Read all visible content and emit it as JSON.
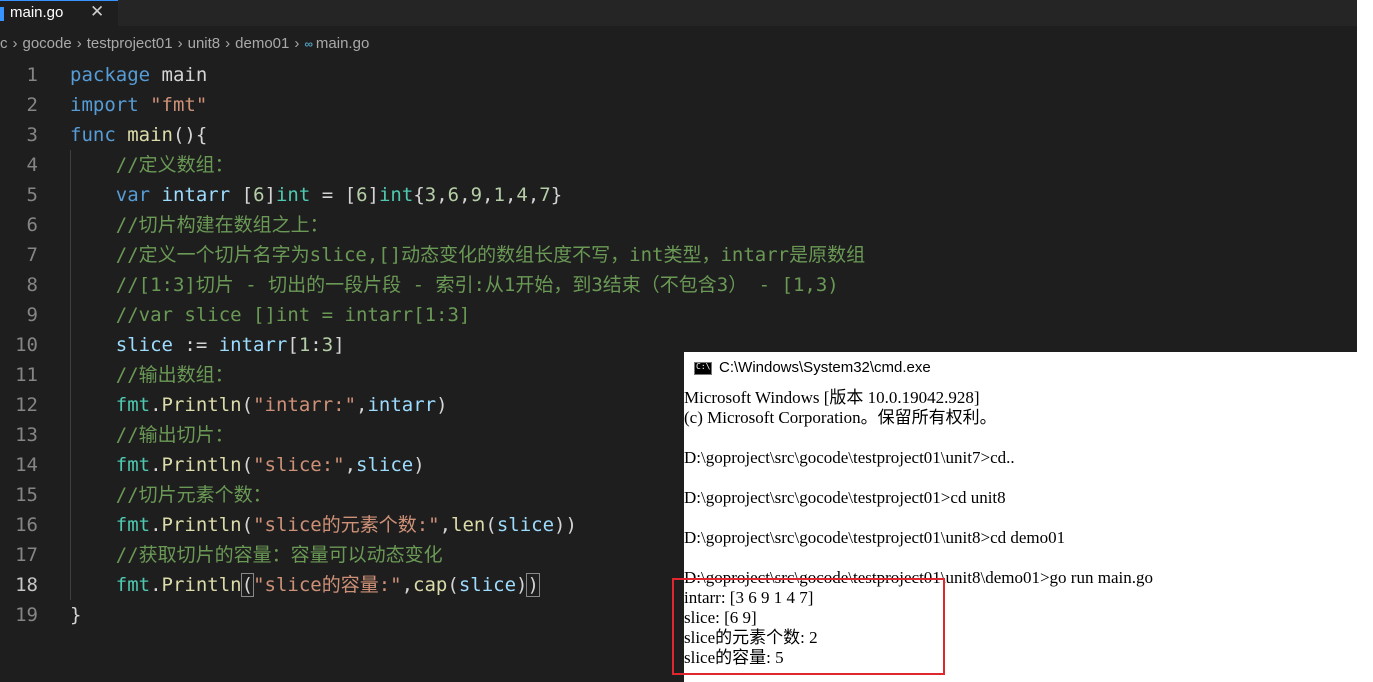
{
  "tab": {
    "label": "main.go",
    "close": "✕"
  },
  "breadcrumb": [
    "c",
    "gocode",
    "testproject01",
    "unit8",
    "demo01",
    "main.go"
  ],
  "breadcrumb_go_icon": "∞",
  "active_line": 18,
  "lines": [
    {
      "n": "1"
    },
    {
      "n": "2"
    },
    {
      "n": "3"
    },
    {
      "n": "4"
    },
    {
      "n": "5"
    },
    {
      "n": "6"
    },
    {
      "n": "7"
    },
    {
      "n": "8"
    },
    {
      "n": "9"
    },
    {
      "n": "10"
    },
    {
      "n": "11"
    },
    {
      "n": "12"
    },
    {
      "n": "13"
    },
    {
      "n": "14"
    },
    {
      "n": "15"
    },
    {
      "n": "16"
    },
    {
      "n": "17"
    },
    {
      "n": "18"
    },
    {
      "n": "19"
    }
  ],
  "code": {
    "l1": [
      "package",
      " main"
    ],
    "l2": [
      "import",
      " ",
      "\"fmt\""
    ],
    "l3": [
      "func",
      " ",
      "main",
      "(){"
    ],
    "l4": "    //定义数组：",
    "l5": [
      "    ",
      "var",
      " ",
      "intarr",
      " [",
      "6",
      "]",
      "int",
      " = [",
      "6",
      "]",
      "int",
      "{",
      "3",
      ",",
      "6",
      ",",
      "9",
      ",",
      "1",
      ",",
      "4",
      ",",
      "7",
      "}"
    ],
    "l6": "    //切片构建在数组之上：",
    "l7": "    //定义一个切片名字为slice,[]动态变化的数组长度不写，int类型，intarr是原数组",
    "l8": "    //[1:3]切片 - 切出的一段片段 - 索引:从1开始，到3结束（不包含3） - [1,3)",
    "l9": "    //var slice []int = intarr[1:3]",
    "l10": [
      "    ",
      "slice",
      " := ",
      "intarr",
      "[",
      "1",
      ":",
      "3",
      "]"
    ],
    "l11": "    //输出数组：",
    "l12": [
      "    ",
      "fmt",
      ".",
      "Println",
      "(",
      "\"intarr:\"",
      ",",
      "intarr",
      ")"
    ],
    "l13": "    //输出切片：",
    "l14": [
      "    ",
      "fmt",
      ".",
      "Println",
      "(",
      "\"slice:\"",
      ",",
      "slice",
      ")"
    ],
    "l15": "    //切片元素个数：",
    "l16": [
      "    ",
      "fmt",
      ".",
      "Println",
      "(",
      "\"slice的元素个数:\"",
      ",",
      "len",
      "(",
      "slice",
      "))"
    ],
    "l17": "    //获取切片的容量：容量可以动态变化",
    "l18": [
      "    ",
      "fmt",
      ".",
      "Println",
      "(",
      "\"slice的容量:\"",
      ",",
      "cap",
      "(",
      "slice",
      ")",
      ")"
    ],
    "l19": "}"
  },
  "cmd": {
    "title": "C:\\Windows\\System32\\cmd.exe",
    "lines": [
      "Microsoft Windows [版本 10.0.19042.928]",
      "(c) Microsoft Corporation。保留所有权利。",
      "",
      "D:\\goproject\\src\\gocode\\testproject01\\unit7>cd..",
      "",
      "D:\\goproject\\src\\gocode\\testproject01>cd unit8",
      "",
      "D:\\goproject\\src\\gocode\\testproject01\\unit8>cd demo01",
      "",
      "D:\\goproject\\src\\gocode\\testproject01\\unit8\\demo01>go run main.go",
      "intarr: [3 6 9 1 4 7]",
      "slice: [6 9]",
      "slice的元素个数: 2",
      "slice的容量: 5"
    ]
  },
  "colors": {
    "editor_bg": "#1e1e1e",
    "keyword": "#569cd6",
    "function": "#dcdcaa",
    "string": "#ce9178",
    "comment": "#6a9955",
    "type": "#4ec9b0",
    "number": "#b5cea8",
    "variable": "#9cdcfe",
    "highlight_box": "#e0262f"
  }
}
